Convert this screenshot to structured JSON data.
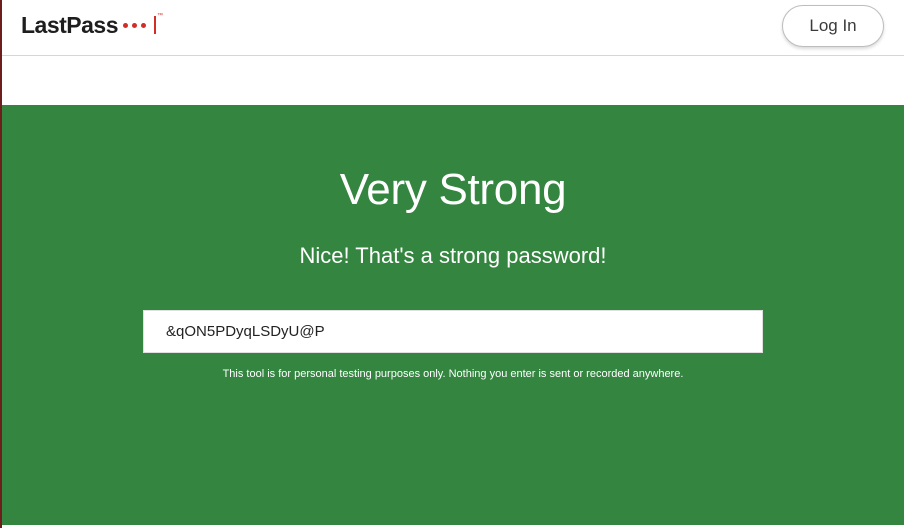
{
  "header": {
    "logo_text": "LastPass",
    "logo_tm": "™",
    "login_label": "Log In"
  },
  "hero": {
    "strength": "Very Strong",
    "message": "Nice! That's a strong password!",
    "password_value": "&qON5PDyqLSDyU@P",
    "disclaimer": "This tool is for personal testing purposes only. Nothing you enter is sent or recorded anywhere."
  },
  "colors": {
    "brand_red": "#d32d27",
    "strength_green": "#348540"
  }
}
